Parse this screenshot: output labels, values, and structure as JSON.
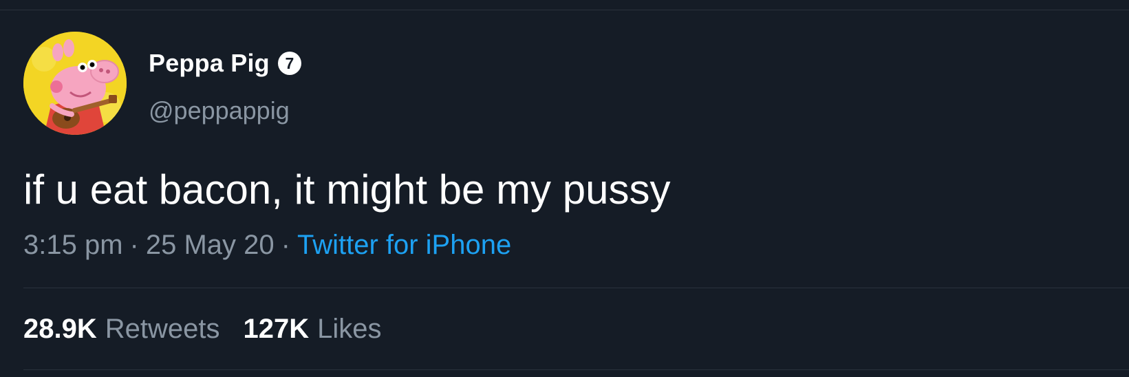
{
  "tweet": {
    "author": {
      "display_name": "Peppa Pig",
      "badge": "7",
      "handle": "@peppappig",
      "avatar_icon": "peppa-pig-avatar"
    },
    "text": "if u eat bacon, it might be my pussy",
    "meta": {
      "time": "3:15 pm",
      "separator": "·",
      "date": "25 May 20",
      "source": "Twitter for iPhone"
    },
    "stats": {
      "retweets_count": "28.9K",
      "retweets_label": "Retweets",
      "likes_count": "127K",
      "likes_label": "Likes"
    }
  },
  "colors": {
    "background": "#151c26",
    "primary_text": "#ffffff",
    "secondary_text": "#8a96a3",
    "link": "#1da1f2",
    "divider": "#2a323d",
    "avatar_background": "#f3d524"
  }
}
